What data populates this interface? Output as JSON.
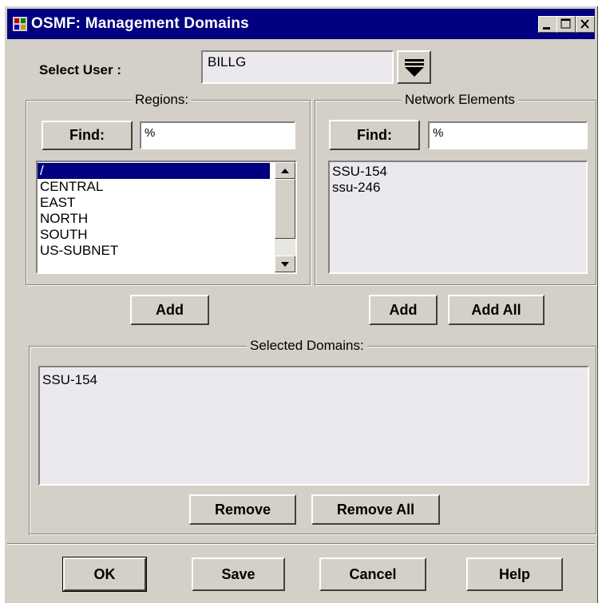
{
  "window": {
    "title": "OSMF: Management Domains"
  },
  "user": {
    "label": "Select User :",
    "value": "BILLG"
  },
  "regions": {
    "legend": "Regions:",
    "find_label": "Find:",
    "filter": "%",
    "items": [
      "/",
      "CENTRAL",
      "EAST",
      "NORTH",
      "SOUTH",
      "US-SUBNET"
    ],
    "selected_index": 0,
    "add_label": "Add"
  },
  "network": {
    "legend": "Network Elements",
    "find_label": "Find:",
    "filter": "%",
    "items": [
      "SSU-154",
      "ssu-246"
    ],
    "add_label": "Add",
    "add_all_label": "Add All"
  },
  "selected": {
    "legend": "Selected Domains:",
    "items": [
      "SSU-154"
    ],
    "remove_label": "Remove",
    "remove_all_label": "Remove All"
  },
  "footer": {
    "ok": "OK",
    "save": "Save",
    "cancel": "Cancel",
    "help": "Help"
  }
}
